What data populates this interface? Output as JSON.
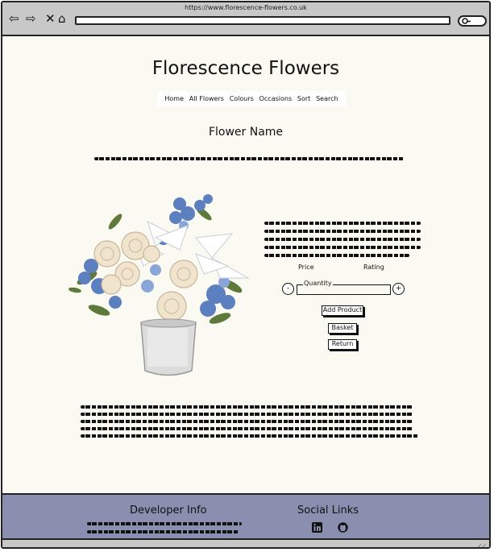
{
  "browser": {
    "url": "https://www.florescence-flowers.co.uk",
    "back_icon": "arrow-left-icon",
    "forward_icon": "arrow-right-icon",
    "stop_icon": "close-icon",
    "home_icon": "home-icon",
    "search_icon": "search-icon"
  },
  "site": {
    "title": "Florescence Flowers"
  },
  "nav": {
    "items": [
      "Home",
      "All Flowers",
      "Colours",
      "Occasions",
      "Sort",
      "Search"
    ]
  },
  "product": {
    "name": "Flower Name",
    "price_label": "Price",
    "rating_label": "Rating",
    "quantity_label": "Quantity",
    "minus_label": "-",
    "plus_label": "+",
    "add_product_label": "Add Product",
    "basket_label": "Basket",
    "return_label": "Return",
    "image_alt_icon": "flower-bouquet-image"
  },
  "footer": {
    "developer_heading": "Developer Info",
    "social_heading": "Social Links",
    "linkedin_icon": "linkedin-icon",
    "github_icon": "github-icon"
  },
  "colors": {
    "page_bg": "#fbfaf2",
    "footer_bg": "#8a8fb0",
    "chrome_bg": "#c8c8c8"
  }
}
